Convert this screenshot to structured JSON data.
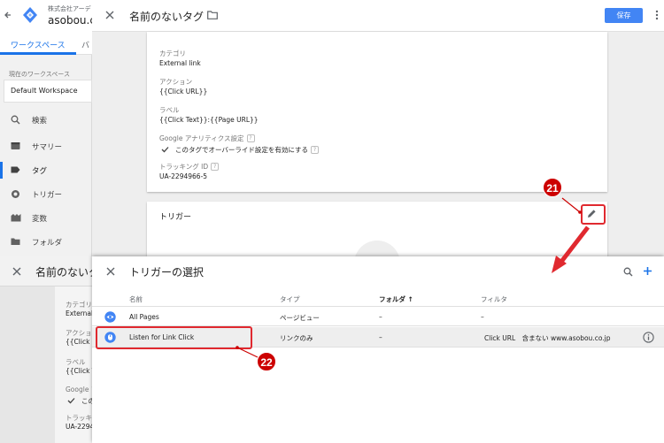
{
  "app": {
    "company": "株式会社アーデ",
    "account": "asobou.co",
    "accent_color": "#1a73e8",
    "tab_active": "ワークスペース",
    "tab_next": "バ"
  },
  "workspace": {
    "label": "現在のワークスペース",
    "name": "Default Workspace"
  },
  "sidebar": {
    "search_label": "検索",
    "items": [
      {
        "label": "サマリー",
        "icon": "summary-icon"
      },
      {
        "label": "タグ",
        "icon": "tag-icon"
      },
      {
        "label": "トリガー",
        "icon": "trigger-icon"
      },
      {
        "label": "変数",
        "icon": "variable-icon"
      },
      {
        "label": "フォルダ",
        "icon": "folder-icon"
      }
    ]
  },
  "tag_editor": {
    "title": "名前のないタグ",
    "save_label": "保存",
    "category_label": "カテゴリ",
    "category_value": "External link",
    "action_label": "アクション",
    "action_value": "{{Click URL}}",
    "label_label": "ラベル",
    "label_value": "{{Click Text}}:{{Page URL}}",
    "ga_settings_label": "Google アナリティクス設定",
    "override_label": "このタグでオーバーライド設定を有効にする",
    "tracking_id_label": "トラッキング ID",
    "tracking_id_value": "UA-2294966-5",
    "trigger_section_label": "トリガー"
  },
  "background_tag_editor": {
    "title": "名前のないタ",
    "category_label": "カテゴリ",
    "category_value": "External l",
    "action_label": "アクショ",
    "action_value": "{{Click UR",
    "label_label": "ラベル",
    "label_value": "{{Click Te",
    "ga_label": "Google ア",
    "override_label": "この",
    "tracking_label": "トラッキン",
    "tracking_value": "UA-22949"
  },
  "trigger_chooser": {
    "title": "トリガーの選択",
    "columns": {
      "name": "名前",
      "type": "タイプ",
      "folder": "フォルダ ↑",
      "filter": "フィルタ"
    },
    "rows": [
      {
        "name": "All Pages",
        "type": "ページビュー",
        "folder": "–",
        "filter": "–",
        "icon": "eye-icon"
      },
      {
        "name": "Listen for Link Click",
        "type": "リンクのみ",
        "folder": "–",
        "filter": "Click URL　含まない www.asobou.co.jp",
        "icon": "link-click-icon"
      }
    ]
  },
  "annotations": {
    "badge_21": "21",
    "badge_22": "22",
    "highlight_color": "#e0292f"
  }
}
